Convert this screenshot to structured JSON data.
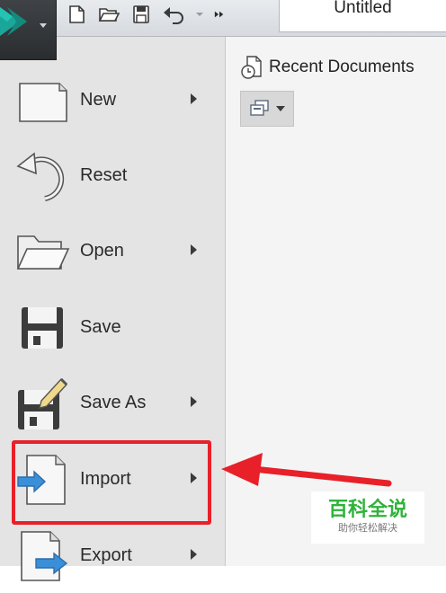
{
  "window": {
    "document_title": "Untitled"
  },
  "app_menu": {
    "items": [
      {
        "label": "New",
        "icon": "new-document-icon",
        "has_submenu": true
      },
      {
        "label": "Reset",
        "icon": "reset-icon",
        "has_submenu": false
      },
      {
        "label": "Open",
        "icon": "open-folder-icon",
        "has_submenu": true
      },
      {
        "label": "Save",
        "icon": "save-icon",
        "has_submenu": false
      },
      {
        "label": "Save As",
        "icon": "save-as-icon",
        "has_submenu": true
      },
      {
        "label": "Import",
        "icon": "import-icon",
        "has_submenu": true
      },
      {
        "label": "Export",
        "icon": "export-icon",
        "has_submenu": true
      }
    ]
  },
  "quick_access": {
    "icons": [
      "new-icon",
      "open-icon",
      "save-icon",
      "undo-icon",
      "dropdown-icon",
      "more-icon"
    ]
  },
  "recent_panel": {
    "title": "Recent Documents",
    "view_button_icon": "view-options-icon"
  },
  "annotation": {
    "highlighted_item": "Import",
    "highlight_color": "#e8202a"
  },
  "watermark": {
    "title": "百科全说",
    "subtitle": "助你轻松解决"
  },
  "colors": {
    "menu_background": "#e4e4e4",
    "panel_background": "#f4f4f4",
    "logo_teal": "#1aa79a",
    "watermark_green": "#2fb33a"
  }
}
